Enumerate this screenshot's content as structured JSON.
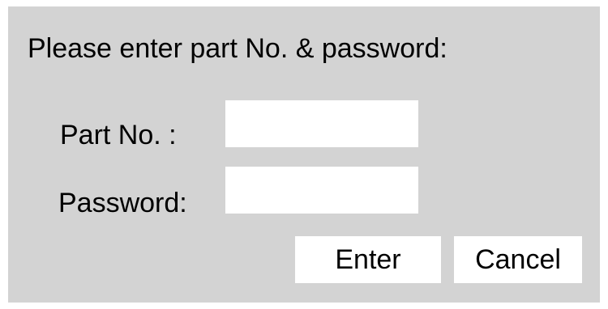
{
  "dialog": {
    "prompt": "Please enter part No. & password:",
    "part_no": {
      "label": "Part No. :",
      "value": ""
    },
    "password": {
      "label": "Password:",
      "value": ""
    },
    "buttons": {
      "enter": "Enter",
      "cancel": "Cancel"
    }
  },
  "colors": {
    "dialog_background": "#d3d3d3",
    "field_background": "#ffffff",
    "text": "#000000"
  }
}
